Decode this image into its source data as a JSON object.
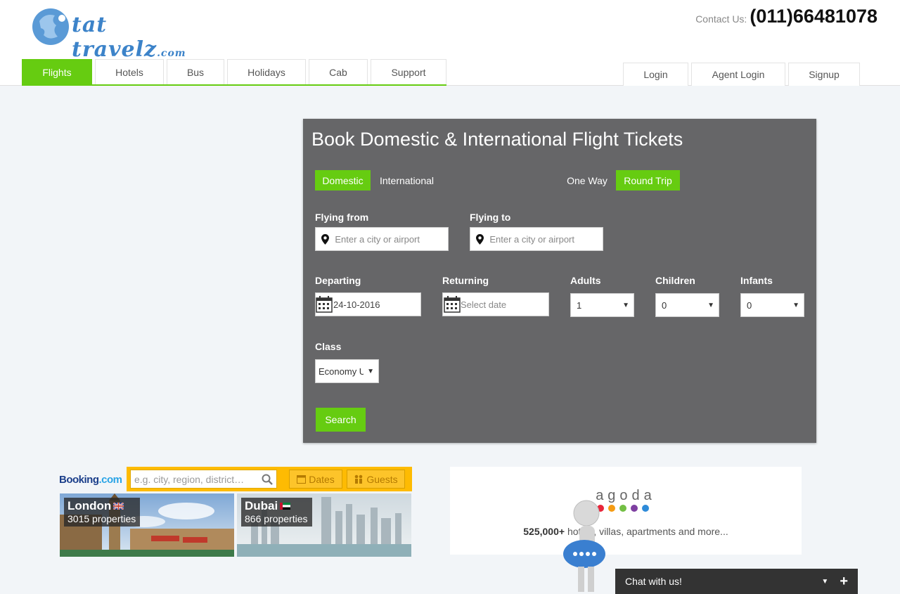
{
  "header": {
    "logo_text": "tat travelz",
    "logo_domain": ".com",
    "contact_label": "Contact Us:",
    "contact_number": "(011)66481078"
  },
  "nav": {
    "tabs": [
      {
        "label": "Flights",
        "active": true
      },
      {
        "label": "Hotels",
        "active": false
      },
      {
        "label": "Bus",
        "active": false
      },
      {
        "label": "Holidays",
        "active": false
      },
      {
        "label": "Cab",
        "active": false
      },
      {
        "label": "Support",
        "active": false
      }
    ],
    "auth": [
      "Login",
      "Agent Login",
      "Signup"
    ]
  },
  "search": {
    "title": "Book Domestic & International Flight Tickets",
    "scope": {
      "domestic": "Domestic",
      "international": "International",
      "selected": "Domestic"
    },
    "trip": {
      "one_way": "One Way",
      "round_trip": "Round Trip",
      "selected": "Round Trip"
    },
    "from": {
      "label": "Flying from",
      "placeholder": "Enter a city or airport"
    },
    "to": {
      "label": "Flying to",
      "placeholder": "Enter a city or airport"
    },
    "departing": {
      "label": "Departing",
      "value": "24-10-2016"
    },
    "returning": {
      "label": "Returning",
      "placeholder": "Select date"
    },
    "adults": {
      "label": "Adults",
      "value": "1"
    },
    "children": {
      "label": "Children",
      "value": "0"
    },
    "infants": {
      "label": "Infants",
      "value": "0"
    },
    "class": {
      "label": "Class",
      "value": "Economy U"
    },
    "button": "Search"
  },
  "booking": {
    "logo_main": "Booking",
    "logo_dot": ".com",
    "placeholder": "e.g. city, region, district…",
    "dates_label": "Dates",
    "guests_label": "Guests",
    "destinations": [
      {
        "city": "London",
        "properties": "3015 properties",
        "flag": "uk-flag-icon"
      },
      {
        "city": "Dubai",
        "properties": "866 properties",
        "flag": "uae-flag-icon"
      }
    ]
  },
  "agoda": {
    "logo": "agoda",
    "count": "525,000+",
    "text": " hotels, villas, apartments and more..."
  },
  "chat": {
    "label": "Chat with us!"
  },
  "colors": {
    "accent": "#66cc11",
    "panel": "#666668",
    "booking_yellow": "#febb02",
    "logo_blue": "#3c83c9"
  }
}
